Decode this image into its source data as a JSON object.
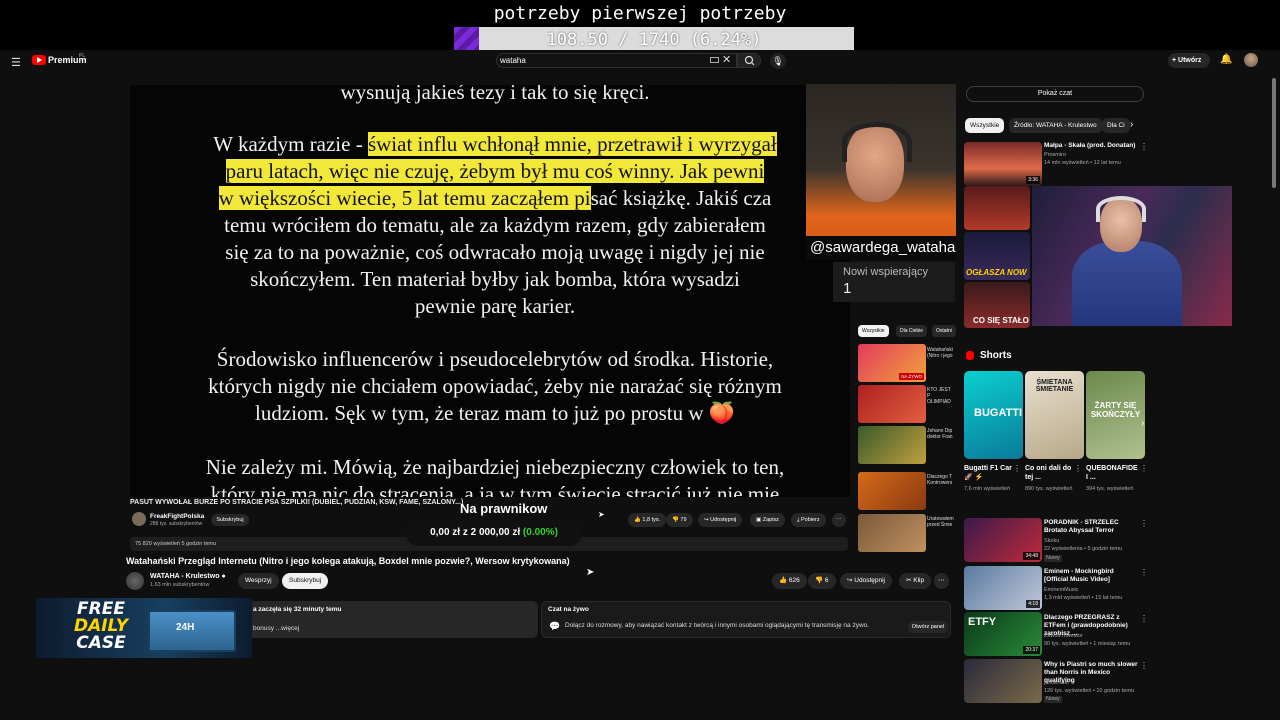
{
  "overlay": {
    "goal_title": "potrzeby pierwszej potrzeby",
    "goal_progress": "108.50 / 1740 (6.24%)",
    "goal_fraction": 0.0624,
    "webcam_tag": "@sawardega_wataha",
    "new_supporters_label": "Nowi wspierający",
    "new_supporters_count": "1",
    "lawyer_title": "Na prawnikow",
    "lawyer_raised": "0,00 zł",
    "lawyer_sep": "z",
    "lawyer_goal": "2 000,00 zł",
    "lawyer_pct": "(0.00%)"
  },
  "header": {
    "menu_icon": "menu-icon",
    "logo": "Premium",
    "logo_region": "PL",
    "search_value": "wataha",
    "create_label": "Utwórz"
  },
  "video_text": {
    "line0": "wysnują jakieś tezy i tak to się kręci.",
    "p1_pre": "W każdym razie - ",
    "p1_hl1": "świat influ wchłonął mnie, przetrawił i wyrzygał",
    "p1_hl2": "paru latach, więc nie czuję, żebym był mu coś winny. Jak pewni",
    "p1_hl3": "w większości wiecie, 5 lat temu zacząłem pi",
    "p1_rest3": "sać książkę. Jakiś cza",
    "p1_l4": "temu wróciłem do tematu, ale za każdym razem, gdy zabierałem",
    "p1_l5": "się za to na poważnie, coś odwracało moją uwagę i nigdy jej nie",
    "p1_l6": "skończyłem. Ten materiał byłby jak bomba, która wysadzi",
    "p1_l7": "pewnie parę karier.",
    "p2_l1": "Środowisko influencerów i pseudocelebrytów od środka. Historie,",
    "p2_l2": "których nigdy nie chciałem opowiadać, żeby nie narażać się różnym",
    "p2_l3": "ludziom. Sęk w tym, że teraz mam to już po prostu w 🍑",
    "p3_l1": "Nie zależy mi. Mówią, że najbardziej niebezpieczny człowiek to ten,",
    "p3_l2": "który nie ma nic do stracenia, a ja w tym świecie stracić już nie mię"
  },
  "stream_video": {
    "title": "PASUT WYWOŁAŁ BURZE PO STRACIE PSA SZPILKI! (DUBIEL, PUDZIAN, KSW, FAME, SZALONY...)",
    "channel": "FreakFightPolska",
    "subs": "288 tys. subskrybentów",
    "subscribe": "Subskrybuj",
    "likes": "1,8 tys.",
    "dislikes": "79",
    "share": "Udostępnij",
    "save": "Zapisz",
    "download": "Pobierz",
    "views": "75 820 wyświetleń 5 godzin temu"
  },
  "mini_chips": [
    "Wszystkie",
    "Dla Ciebie",
    "Ostatni"
  ],
  "mini_list": [
    {
      "title": "Watahański",
      "sub": "(Nitro i jego",
      "badge": "NA ŻYWO"
    },
    {
      "title": "KTO JEST P",
      "sub": "OLIMPIAD"
    },
    {
      "title": "Johann Dip",
      "sub": "doktor Fran"
    },
    {
      "title": "Dlaczego T",
      "sub": "Kontrowers"
    },
    {
      "title": "Uratowałem",
      "sub": "przed Śmie"
    }
  ],
  "main": {
    "title": "Watahański Przegląd Internetu (Nitro i jego kolega atakują, Boxdel mnie pozwie?, Wersow krytykowana)",
    "channel": "WATAHA - Krulestwo",
    "subs": "1,63 mln subskrybentów",
    "support": "Wesprzyj",
    "subscribe": "Subskrybuj",
    "likes": "626",
    "dislikes": "6",
    "share": "Udostępnij",
    "clip": "Klip",
    "desc_line1": "a zaczęła się 32 minuty temu",
    "desc_line2": "bonusy   ...więcej",
    "chat_title": "Czat na żywo",
    "chat_text": "Dołącz do rozmowy, aby nawiązać kontakt z twórcą i innymi osobami oglądającymi tę transmisję na żywo.",
    "open_panel": "Otwórz panel"
  },
  "sidebar": {
    "show_chat": "Pokaż czat",
    "chips": [
      "Wszystkie",
      "Źródło: WATAHA - Krulestwo",
      "Dla Ci"
    ],
    "items": [
      {
        "title": "Małpa - Skała (prod. Donatan)",
        "channel": "Prosmiro",
        "meta": "14 mln wyświetleń • 12 lat temu",
        "duration": "3:36"
      },
      {
        "title": "PORADNIK - STRZELEC Brotato Abyssal Terror",
        "channel": "Skoku",
        "meta": "22 wyświetlenia • 5 godzin temu",
        "badge": "Nowy",
        "duration": "34:48"
      },
      {
        "title": "Eminem - Mockingbird [Official Music Video]",
        "channel": "EminemMusic",
        "meta": "1,3 mld wyświetleń • 15 lat temu",
        "duration": "4:18"
      },
      {
        "title": "Dlaczego PRZEGRASZ z ETFem i (prawdopodobnie) zarobisz ...",
        "channel": "Zawód Inwestor",
        "meta": "90 tys. wyświetleń • 1 miesiąc temu",
        "duration": "20:37"
      },
      {
        "title": "Why is Piastri so much slower than Norris in Mexico qualifying",
        "channel": "jellotenner",
        "meta": "126 tys. wyświetleń • 10 godzin temu",
        "badge": "Nowy"
      }
    ],
    "shorts_title": "Shorts",
    "shorts": [
      {
        "title": "Bugatti F1 Car 🚀 ⚡",
        "meta": "7,6 mln wyświetleń",
        "thumb": "BUGATTI"
      },
      {
        "title": "Co oni dali do tej ...",
        "meta": "890 tys. wyświetleń",
        "thumb": "ŚMIETANA ŚMIETANIE"
      },
      {
        "title": "QUEBONAFIDE I ...",
        "meta": "394 tys. wyświetleń",
        "thumb": "ŻARTY SIĘ SKOŃCZYŁY"
      }
    ],
    "thumb_texts": {
      "ogasza": "OGŁASZA NOW",
      "stalo": "CO SIĘ STAŁO"
    }
  },
  "ad": {
    "line1": "FREE",
    "line2": "DAILY",
    "line3": "CASE",
    "crate": "24H"
  },
  "colors": {
    "accent": "#ff0000",
    "highlight": "#f2e83a",
    "goal": "#7a2ad8",
    "green": "#31d331"
  }
}
